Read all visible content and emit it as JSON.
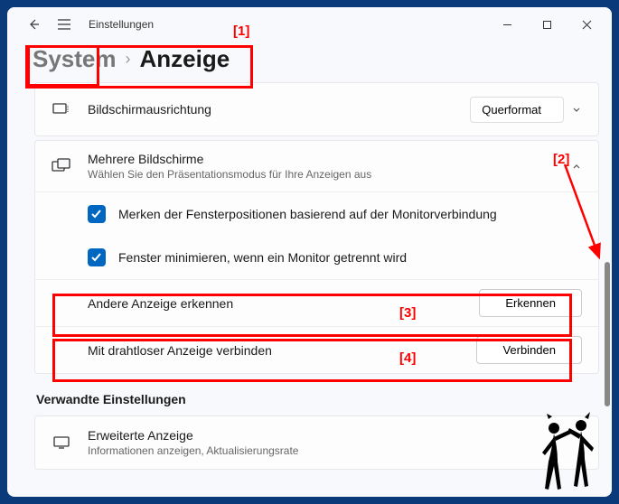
{
  "titlebar": {
    "title": "Einstellungen"
  },
  "breadcrumb": {
    "parent": "System",
    "current": "Anzeige"
  },
  "orientation": {
    "label": "Bildschirmausrichtung",
    "value": "Querformat"
  },
  "multi": {
    "title": "Mehrere Bildschirme",
    "subtitle": "Wählen Sie den Präsentationsmodus für Ihre Anzeigen aus",
    "check1": "Merken der Fensterpositionen basierend auf der Monitorverbindung",
    "check2": "Fenster minimieren, wenn ein Monitor getrennt wird",
    "detect_label": "Andere Anzeige erkennen",
    "detect_btn": "Erkennen",
    "wireless_label": "Mit drahtloser Anzeige verbinden",
    "wireless_btn": "Verbinden"
  },
  "related": {
    "heading": "Verwandte Einstellungen",
    "advanced_title": "Erweiterte Anzeige",
    "advanced_sub": "Informationen anzeigen, Aktualisierungsrate"
  },
  "annotations": {
    "a1": "[1]",
    "a2": "[2]",
    "a3": "[3]",
    "a4": "[4]"
  }
}
